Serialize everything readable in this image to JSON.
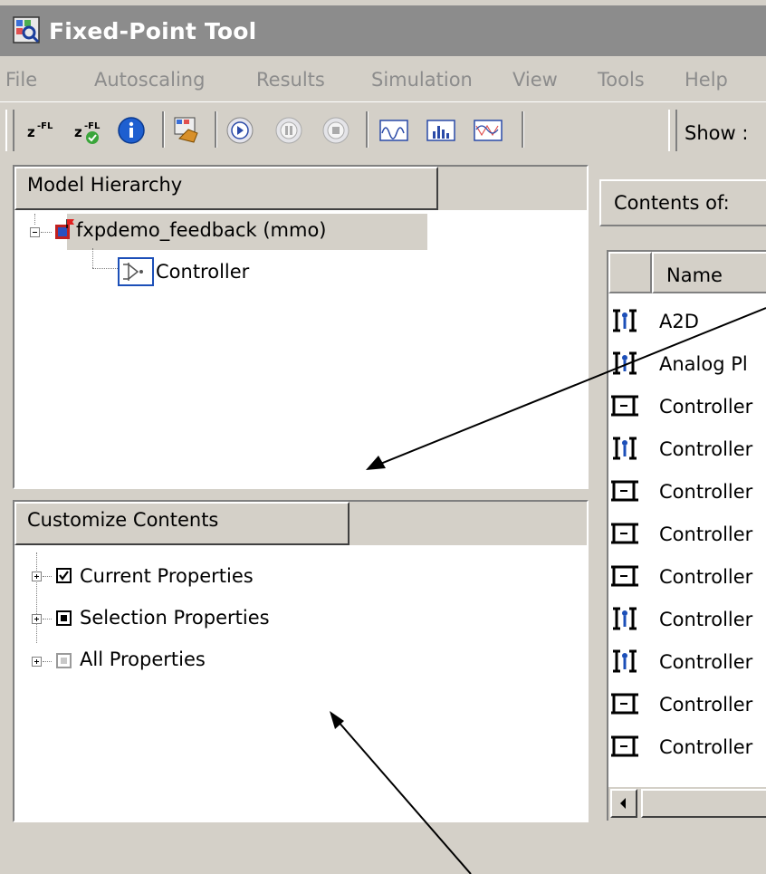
{
  "window": {
    "title": "Fixed-Point Tool"
  },
  "menu": [
    "File",
    "Autoscaling",
    "Results",
    "Simulation",
    "View",
    "Tools",
    "Help"
  ],
  "toolbar": {
    "show_label": "Show :",
    "icons": [
      "propose-fl-icon",
      "apply-fl-icon",
      "info-icon",
      "explore-icon",
      "start-icon",
      "pause-icon",
      "stop-icon",
      "plot-signal-icon",
      "histogram-icon",
      "plot-compare-icon"
    ]
  },
  "model_hierarchy": {
    "header": "Model Hierarchy",
    "root": "fxpdemo_feedback (mmo)",
    "child": "Controller"
  },
  "customize": {
    "header": "Customize Contents",
    "items": [
      {
        "label": "Current Properties",
        "state": "checked"
      },
      {
        "label": "Selection Properties",
        "state": "partial"
      },
      {
        "label": "All Properties",
        "state": "disabled"
      }
    ]
  },
  "contents": {
    "label": "Contents of:",
    "column_name": "Name",
    "rows": [
      {
        "name": "A2D",
        "icon": "signal-icon"
      },
      {
        "name": "Analog Pl",
        "icon": "signal-icon"
      },
      {
        "name": "Controller",
        "icon": "block-icon"
      },
      {
        "name": "Controller",
        "icon": "signal-icon"
      },
      {
        "name": "Controller",
        "icon": "block-icon"
      },
      {
        "name": "Controller",
        "icon": "block-icon"
      },
      {
        "name": "Controller",
        "icon": "block-icon"
      },
      {
        "name": "Controller",
        "icon": "signal-icon"
      },
      {
        "name": "Controller",
        "icon": "signal-icon"
      },
      {
        "name": "Controller",
        "icon": "block-icon"
      },
      {
        "name": "Controller",
        "icon": "block-icon"
      }
    ]
  }
}
